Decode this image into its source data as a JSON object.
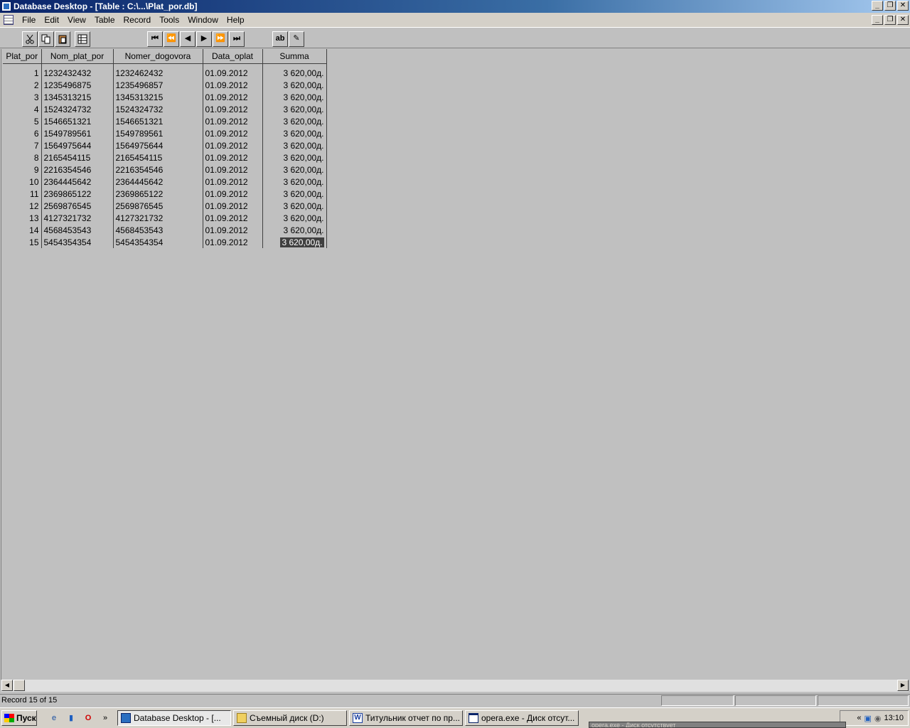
{
  "window": {
    "title": "Database Desktop - [Table : C:\\...\\Plat_por.db]",
    "min_label": "_",
    "restore_label": "❐",
    "close_label": "✕"
  },
  "menu": [
    "File",
    "Edit",
    "View",
    "Table",
    "Record",
    "Tools",
    "Window",
    "Help"
  ],
  "toolbar": {
    "cut_icon": "scissors-icon",
    "copy_icon": "copy-icon",
    "paste_icon": "paste-icon",
    "props_icon": "properties-icon",
    "first": "⏮",
    "prev_set": "⏪",
    "prev": "◀",
    "next": "▶",
    "next_set": "⏩",
    "last": "⏭",
    "field_view": "ab",
    "edit_data": "✎"
  },
  "table": {
    "columns": [
      "Plat_por",
      "Nom_plat_por",
      "Nomer_dogovora",
      "Data_oplat",
      "Summa"
    ],
    "rows": [
      [
        "1",
        "1232432432",
        "1232462432",
        "01.09.2012",
        "3 620,00д."
      ],
      [
        "2",
        "1235496875",
        "1235496857",
        "01.09.2012",
        "3 620,00д."
      ],
      [
        "3",
        "1345313215",
        "1345313215",
        "01.09.2012",
        "3 620,00д."
      ],
      [
        "4",
        "1524324732",
        "1524324732",
        "01.09.2012",
        "3 620,00д."
      ],
      [
        "5",
        "1546651321",
        "1546651321",
        "01.09.2012",
        "3 620,00д."
      ],
      [
        "6",
        "1549789561",
        "1549789561",
        "01.09.2012",
        "3 620,00д."
      ],
      [
        "7",
        "1564975644",
        "1564975644",
        "01.09.2012",
        "3 620,00д."
      ],
      [
        "8",
        "2165454115",
        "2165454115",
        "01.09.2012",
        "3 620,00д."
      ],
      [
        "9",
        "2216354546",
        "2216354546",
        "01.09.2012",
        "3 620,00д."
      ],
      [
        "10",
        "2364445642",
        "2364445642",
        "01.09.2012",
        "3 620,00д."
      ],
      [
        "11",
        "2369865122",
        "2369865122",
        "01.09.2012",
        "3 620,00д."
      ],
      [
        "12",
        "2569876545",
        "2569876545",
        "01.09.2012",
        "3 620,00д."
      ],
      [
        "13",
        "4127321732",
        "4127321732",
        "01.09.2012",
        "3 620,00д."
      ],
      [
        "14",
        "4568453543",
        "4568453543",
        "01.09.2012",
        "3 620,00д."
      ],
      [
        "15",
        "5454354354",
        "5454354354",
        "01.09.2012",
        "3 620,00д."
      ]
    ],
    "selected_row": 14
  },
  "status": {
    "text": "Record 15 of 15"
  },
  "taskbar": {
    "start": "Пуск",
    "more": "»",
    "tasks": [
      {
        "label": "Database Desktop - [...",
        "active": true
      },
      {
        "label": "Съемный диск (D:)",
        "active": false
      },
      {
        "label": "Титульник отчет по пр...",
        "active": false
      },
      {
        "label": "opera.exe - Диск отсут...",
        "active": false
      }
    ],
    "tray_chevron": "«",
    "clock": "13:10",
    "ghost_label": "opera.exe - Диск отсутствует"
  }
}
